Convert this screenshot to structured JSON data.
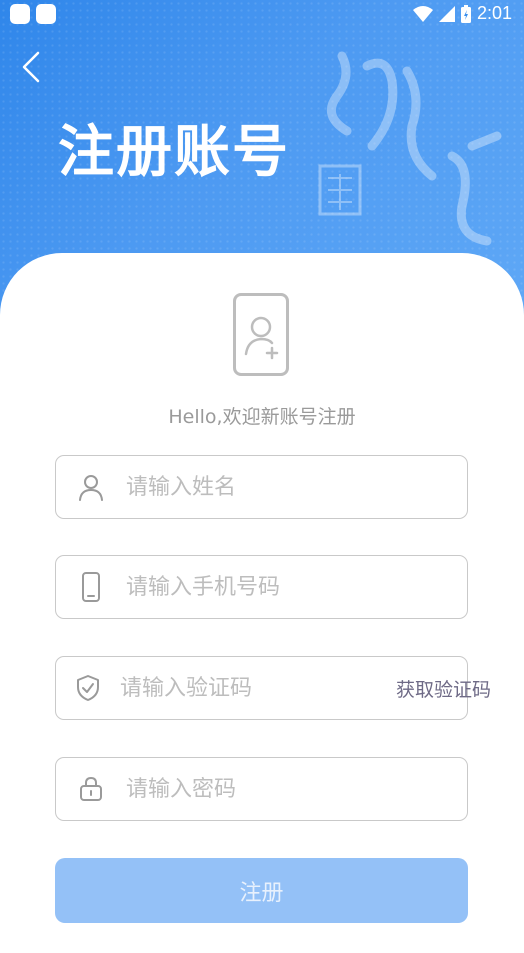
{
  "status_bar": {
    "time": "2:01"
  },
  "header": {
    "title": "注册账号"
  },
  "welcome_text": "Hello,欢迎新账号注册",
  "fields": {
    "name": {
      "placeholder": "请输入姓名",
      "icon": "user-icon"
    },
    "phone": {
      "placeholder": "请输入手机号码",
      "icon": "phone-icon"
    },
    "code": {
      "placeholder": "请输入验证码",
      "icon": "shield-icon",
      "action": "获取验证码"
    },
    "password": {
      "placeholder": "请输入密码",
      "icon": "lock-icon"
    }
  },
  "submit_label": "注册",
  "colors": {
    "header_blue": "#3a8fee",
    "button_disabled": "#94c1f7",
    "border": "#c9c9c9",
    "placeholder": "#bdbdbd"
  }
}
